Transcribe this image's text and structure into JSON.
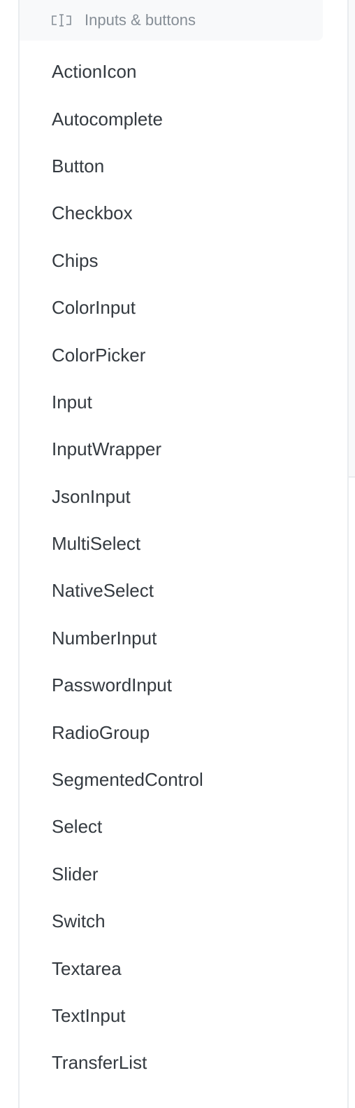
{
  "section": {
    "label": "Inputs & buttons",
    "icon": "input-cursor-icon"
  },
  "items": [
    "ActionIcon",
    "Autocomplete",
    "Button",
    "Checkbox",
    "Chips",
    "ColorInput",
    "ColorPicker",
    "Input",
    "InputWrapper",
    "JsonInput",
    "MultiSelect",
    "NativeSelect",
    "NumberInput",
    "PasswordInput",
    "RadioGroup",
    "SegmentedControl",
    "Select",
    "Slider",
    "Switch",
    "Textarea",
    "TextInput",
    "TransferList"
  ]
}
